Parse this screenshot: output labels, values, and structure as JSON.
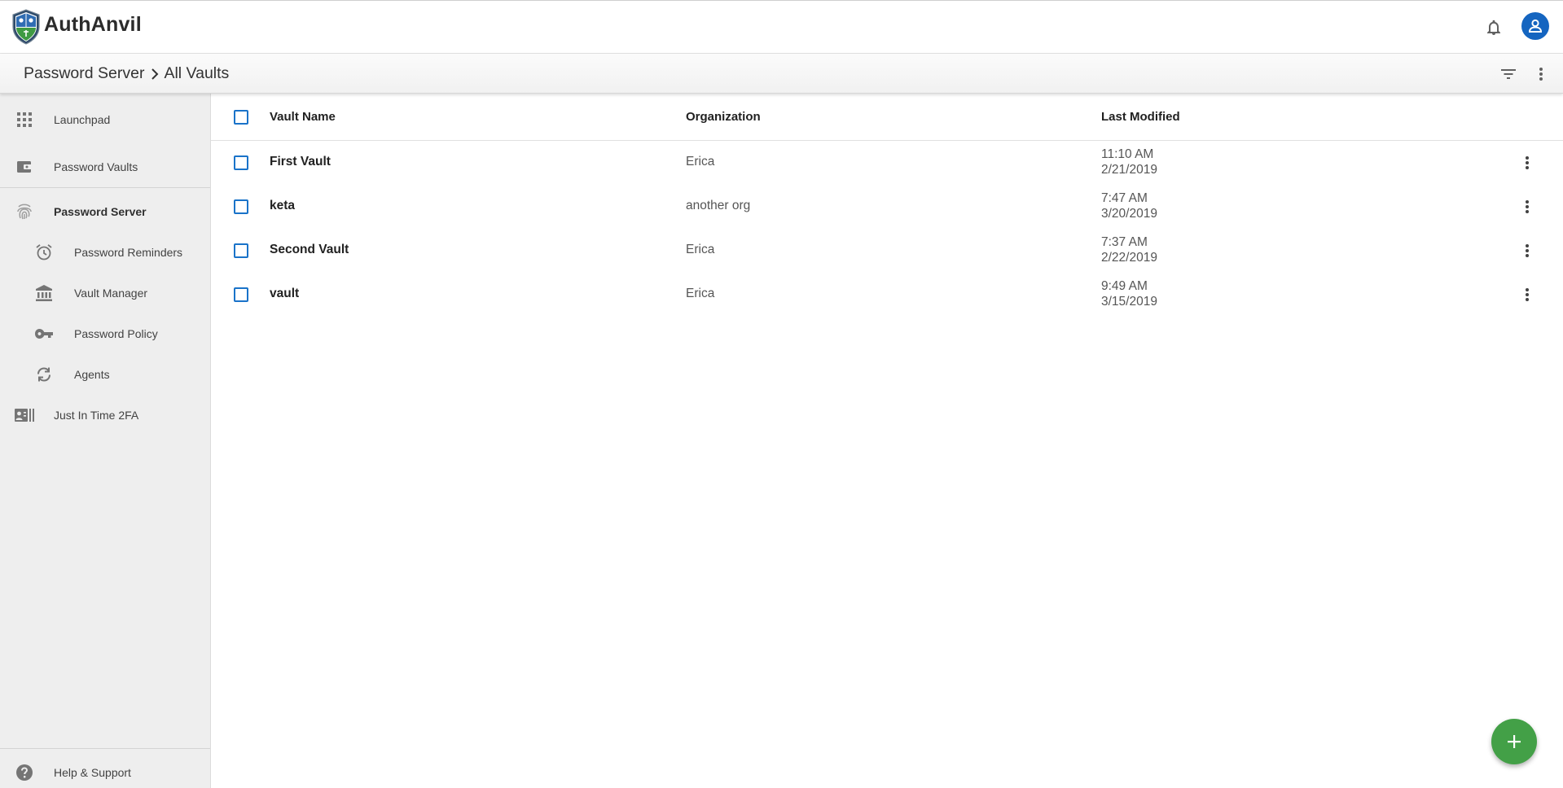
{
  "app": {
    "brand": "AuthAnvil",
    "accent_color": "#1565c0",
    "fab_color": "#43a047",
    "checkbox_color": "#1a73c9"
  },
  "header": {
    "notification_icon": "bell-icon",
    "avatar_icon": "user-avatar-icon"
  },
  "breadcrumb": {
    "parent": "Password Server",
    "current": "All Vaults",
    "filter_icon": "filter-icon",
    "more_icon": "more-vertical-icon"
  },
  "sidebar": {
    "items": [
      {
        "label": "Launchpad",
        "icon": "apps-grid-icon"
      },
      {
        "label": "Password Vaults",
        "icon": "wallet-icon"
      },
      {
        "label": "Password Server",
        "icon": "fingerprint-icon"
      },
      {
        "label": "Password Reminders",
        "icon": "alarm-clock-icon"
      },
      {
        "label": "Vault Manager",
        "icon": "bank-icon"
      },
      {
        "label": "Password Policy",
        "icon": "key-icon"
      },
      {
        "label": "Agents",
        "icon": "sync-icon"
      },
      {
        "label": "Just In Time 2FA",
        "icon": "id-card-icon"
      }
    ],
    "help": {
      "label": "Help & Support",
      "icon": "help-circle-icon"
    }
  },
  "table": {
    "columns": {
      "name": "Vault Name",
      "organization": "Organization",
      "modified": "Last Modified"
    },
    "rows": [
      {
        "name": "First Vault",
        "organization": "Erica",
        "time": "11:10 AM",
        "date": "2/21/2019"
      },
      {
        "name": "keta",
        "organization": "another org",
        "time": "7:47 AM",
        "date": "3/20/2019"
      },
      {
        "name": "Second Vault",
        "organization": "Erica",
        "time": "7:37 AM",
        "date": "2/22/2019"
      },
      {
        "name": "vault",
        "organization": "Erica",
        "time": "9:49 AM",
        "date": "3/15/2019"
      }
    ]
  },
  "fab": {
    "icon": "plus-icon"
  }
}
